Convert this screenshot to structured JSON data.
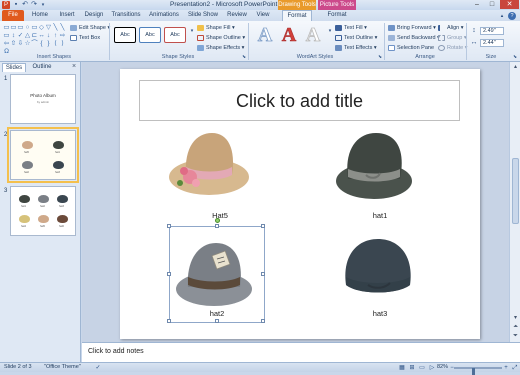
{
  "window": {
    "title": "Presentation2 - Microsoft PowerPoint",
    "context_groups": [
      {
        "label": "Drawing Tools",
        "color": "#e99a2a"
      },
      {
        "label": "Picture Tools",
        "color": "#cc4a8b"
      }
    ],
    "qat_icons": [
      "powerpoint-logo-icon",
      "save-icon",
      "undo-icon",
      "redo-icon",
      "customize-icon"
    ],
    "controls": {
      "minimize": "–",
      "maximize": "□",
      "close": "✕",
      "help": "?"
    }
  },
  "ribbon": {
    "tabs": [
      "File",
      "Home",
      "Insert",
      "Design",
      "Transitions",
      "Animations",
      "Slide Show",
      "Review",
      "View",
      "Format",
      "Format"
    ],
    "active_tab_index": 9,
    "groups": {
      "insert_shapes": {
        "label": "Insert Shapes",
        "edit_shape": "Edit Shape",
        "text_box": "Text Box",
        "shape_glyphs": [
          "▭",
          "▭",
          "▭",
          "○",
          "▭",
          "◇",
          "▽",
          "╲",
          "╲",
          "▭",
          "↕",
          "✓",
          "△",
          "⊏",
          "↔",
          "↓",
          "↑",
          "⇨",
          "⇦",
          "⇧",
          "⇩",
          "☆",
          "⌒",
          "{",
          "}",
          "⟨",
          "⟩",
          "Ω"
        ]
      },
      "shape_styles": {
        "label": "Shape Styles",
        "style_samples": [
          {
            "text": "Abc",
            "border": "#000000"
          },
          {
            "text": "Abc",
            "border": "#4f81bd"
          },
          {
            "text": "Abc",
            "border": "#c0504d"
          }
        ],
        "shape_fill": "Shape Fill",
        "shape_outline": "Shape Outline",
        "shape_effects": "Shape Effects"
      },
      "wordart_styles": {
        "label": "WordArt Styles",
        "letters": [
          {
            "char": "A",
            "color": "#ffffff",
            "stroke": "#7f9fc8"
          },
          {
            "char": "A",
            "color": "#d2403a",
            "stroke": "#a83030"
          },
          {
            "char": "A",
            "color": "#ffffff",
            "stroke": "#bbbbbb"
          }
        ],
        "text_fill": "Text Fill",
        "text_outline": "Text Outline",
        "text_effects": "Text Effects"
      },
      "arrange": {
        "label": "Arrange",
        "bring_forward": "Bring Forward",
        "send_backward": "Send Backward",
        "selection_pane": "Selection Pane",
        "align": "Align",
        "group": "Group",
        "rotate": "Rotate"
      },
      "size": {
        "label": "Size",
        "height": "2.49\"",
        "width": "2.44\""
      }
    }
  },
  "left_pane": {
    "tabs": [
      "Slides",
      "Outline"
    ],
    "active_tab_index": 0,
    "close": "×",
    "slides": [
      {
        "number": "1",
        "title": "Photo Album",
        "subtitle": "by admin"
      },
      {
        "number": "2",
        "labels": [
          "hat5",
          "hat1",
          "hat2",
          "hat3"
        ]
      },
      {
        "number": "3",
        "labels": [
          "hat1",
          "hat2",
          "hat3",
          "hat4",
          "hat5",
          "hat6"
        ]
      }
    ]
  },
  "slide": {
    "title_placeholder": "Click to add title",
    "hats": [
      {
        "label": "Hat5",
        "icon": "straw-hat-icon",
        "colors": {
          "crown": "#c8a47a",
          "brim": "#d7b98f",
          "band": "#e3a9b5",
          "flower": "#e7879a"
        }
      },
      {
        "label": "hat1",
        "icon": "dark-fedora-icon",
        "colors": {
          "crown": "#3f4641",
          "brim": "#4a524c",
          "band": "#8c8f8a"
        }
      },
      {
        "label": "hat2",
        "icon": "gray-fedora-icon",
        "colors": {
          "crown": "#7a7f86",
          "brim": "#8b9097",
          "band": "#5b4a3a",
          "tag": "#e9e2cf"
        }
      },
      {
        "label": "hat3",
        "icon": "cloche-hat-icon",
        "colors": {
          "crown": "#3a4650",
          "brim": "#334049",
          "band": "#2c353d"
        }
      }
    ]
  },
  "notes": {
    "placeholder": "Click to add notes"
  },
  "status": {
    "slide_info": "Slide 2 of 3",
    "theme": "\"Office Theme\"",
    "zoom": "82%",
    "zoom_level": 0.82
  }
}
